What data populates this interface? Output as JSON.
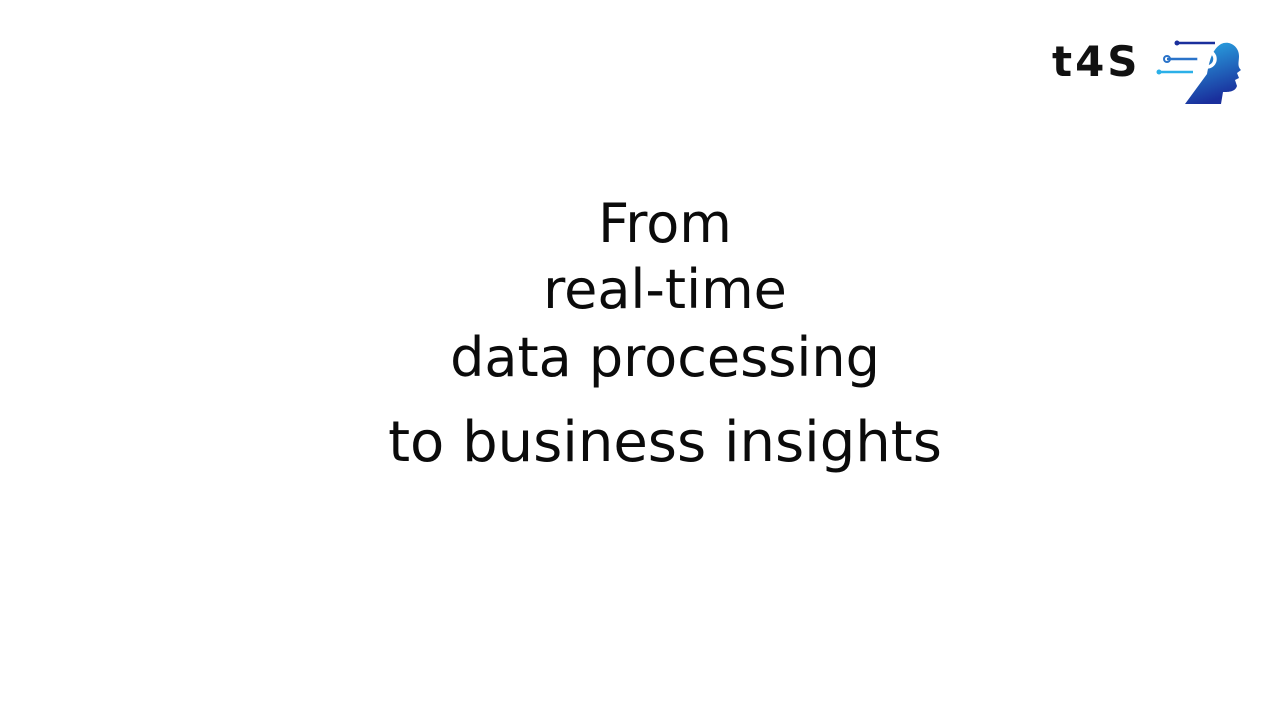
{
  "logo": {
    "text": "t4S",
    "mark_icon": "circuit-head-icon",
    "colors": {
      "gradient_top": "#2bb0e8",
      "gradient_bottom": "#1a2f9c",
      "circuit": "#2a73c9"
    }
  },
  "headline": {
    "line1": "From",
    "line2": "real-time",
    "line3": "data processing",
    "line4": "to business insights"
  }
}
